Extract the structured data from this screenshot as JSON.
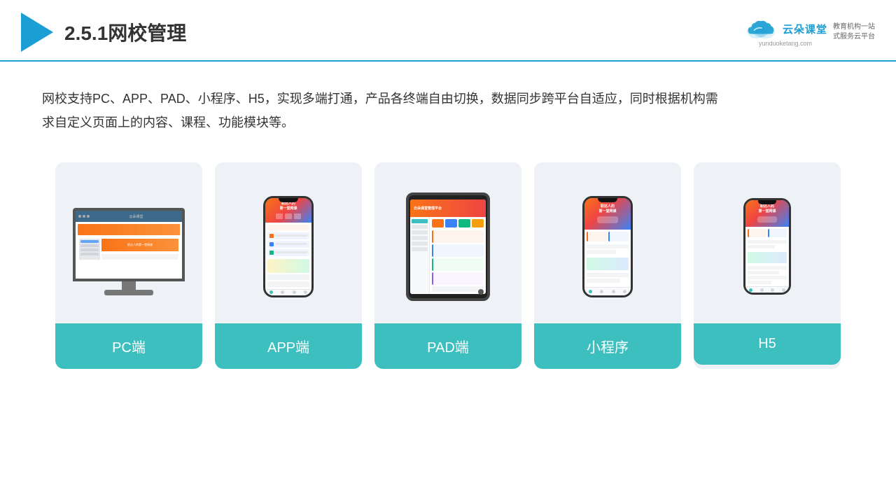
{
  "header": {
    "title": "2.5.1网校管理",
    "brand_name": "云朵课堂",
    "brand_url": "yunduoketang.com",
    "brand_tagline": "教育机构一站\n式服务云平台"
  },
  "description": {
    "text": "网校支持PC、APP、PAD、小程序、H5，实现多端打通，产品各终端自由切换，数据同步跨平台自适应，同时根据机构需求自定义页面上的内容、课程、功能模块等。"
  },
  "cards": [
    {
      "id": "pc",
      "label": "PC端"
    },
    {
      "id": "app",
      "label": "APP端"
    },
    {
      "id": "pad",
      "label": "PAD端"
    },
    {
      "id": "miniprogram",
      "label": "小程序"
    },
    {
      "id": "h5",
      "label": "H5"
    }
  ],
  "colors": {
    "accent": "#1a9ed4",
    "teal": "#3dbfbf",
    "card_bg": "#eef2f7"
  }
}
